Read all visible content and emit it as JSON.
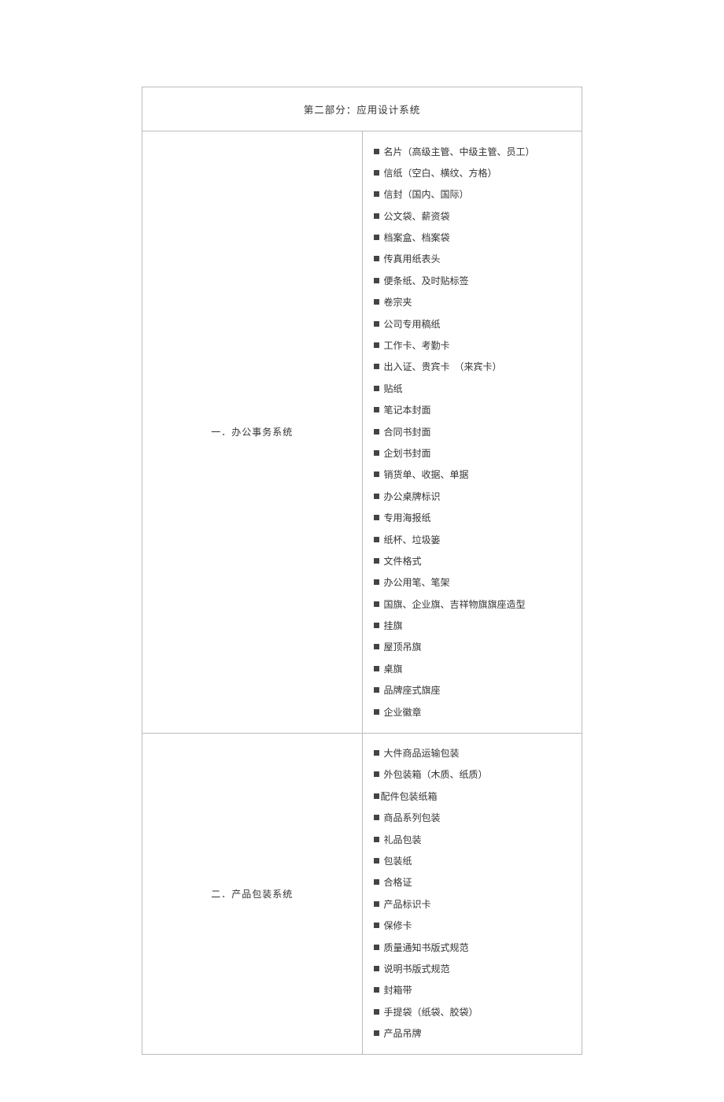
{
  "header": "第二部分：应用设计系统",
  "sections": [
    {
      "label": "一．办公事务系统",
      "items": [
        "名片（高级主管、中级主管、员工）",
        "信纸（空白、横纹、方格）",
        "信封（国内、国际）",
        "公文袋、薪资袋",
        "档案盒、档案袋",
        "传真用纸表头",
        "便条纸、及时贴标签",
        "卷宗夹",
        "公司专用稿纸",
        "工作卡、考勤卡",
        "出入证、贵宾卡　（来宾卡）",
        "贴纸",
        "笔记本封面",
        "合同书封面",
        "企划书封面",
        "销货单、收据、单据",
        "办公桌牌标识",
        "专用海报纸",
        "纸杯、垃圾篓",
        "文件格式",
        "办公用笔、笔架",
        "国旗、企业旗、吉祥物旗旗座造型",
        "挂旗",
        "屋顶吊旗",
        "桌旗",
        "品牌座式旗座",
        "企业徽章"
      ]
    },
    {
      "label": "二．产品包装系统",
      "items": [
        "大件商品运输包装",
        "外包装箱（木质、纸质）",
        {
          "text": "配件包装纸箱",
          "tight": true
        },
        "商品系列包装",
        "礼品包装",
        "包装纸",
        "合格证",
        "产品标识卡",
        "保修卡",
        "质量通知书版式规范",
        "说明书版式规范",
        "封箱带",
        "手提袋（纸袋、胶袋）",
        "产品吊牌"
      ]
    }
  ]
}
